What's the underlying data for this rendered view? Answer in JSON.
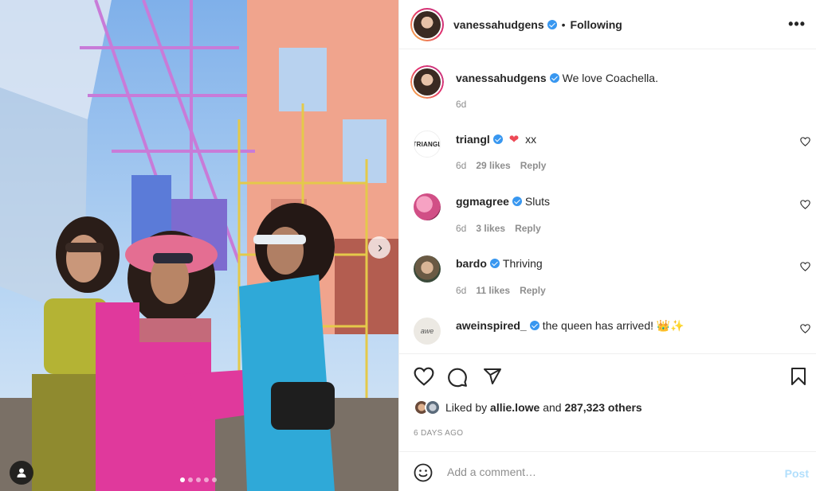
{
  "media": {
    "current_slide": 1,
    "slide_count": 5
  },
  "header": {
    "username": "vanessahudgens",
    "separator": "•",
    "follow_status": "Following",
    "more_icon": "more-horizontal-icon"
  },
  "caption": {
    "username": "vanessahudgens",
    "text": "We love Coachella.",
    "time": "6d"
  },
  "comments": [
    {
      "username": "triangl",
      "avatar_text": "TRIANGL",
      "verified": true,
      "emoji": "❤",
      "text": "xx",
      "time": "6d",
      "likes": "29 likes",
      "reply": "Reply"
    },
    {
      "username": "ggmagree",
      "verified": true,
      "text": "Sluts",
      "time": "6d",
      "likes": "3 likes",
      "reply": "Reply"
    },
    {
      "username": "bardo",
      "verified": true,
      "text": "Thriving",
      "time": "6d",
      "likes": "11 likes",
      "reply": "Reply"
    },
    {
      "username": "aweinspired_",
      "avatar_text": "awe",
      "verified": true,
      "text": "the queen has arrived! 👑✨"
    }
  ],
  "actions": {
    "liked_by_prefix": "Liked by",
    "liked_by_user": "allie.lowe",
    "liked_by_and": "and",
    "liked_by_others": "287,323 others",
    "time_ago": "6 DAYS AGO"
  },
  "comment_box": {
    "placeholder": "Add a comment…",
    "post_label": "Post"
  },
  "colors": {
    "verified": "#3897f0",
    "heart_red": "#ed4956",
    "post_disabled": "#b2dffc",
    "muted_text": "#8e8e8e"
  }
}
